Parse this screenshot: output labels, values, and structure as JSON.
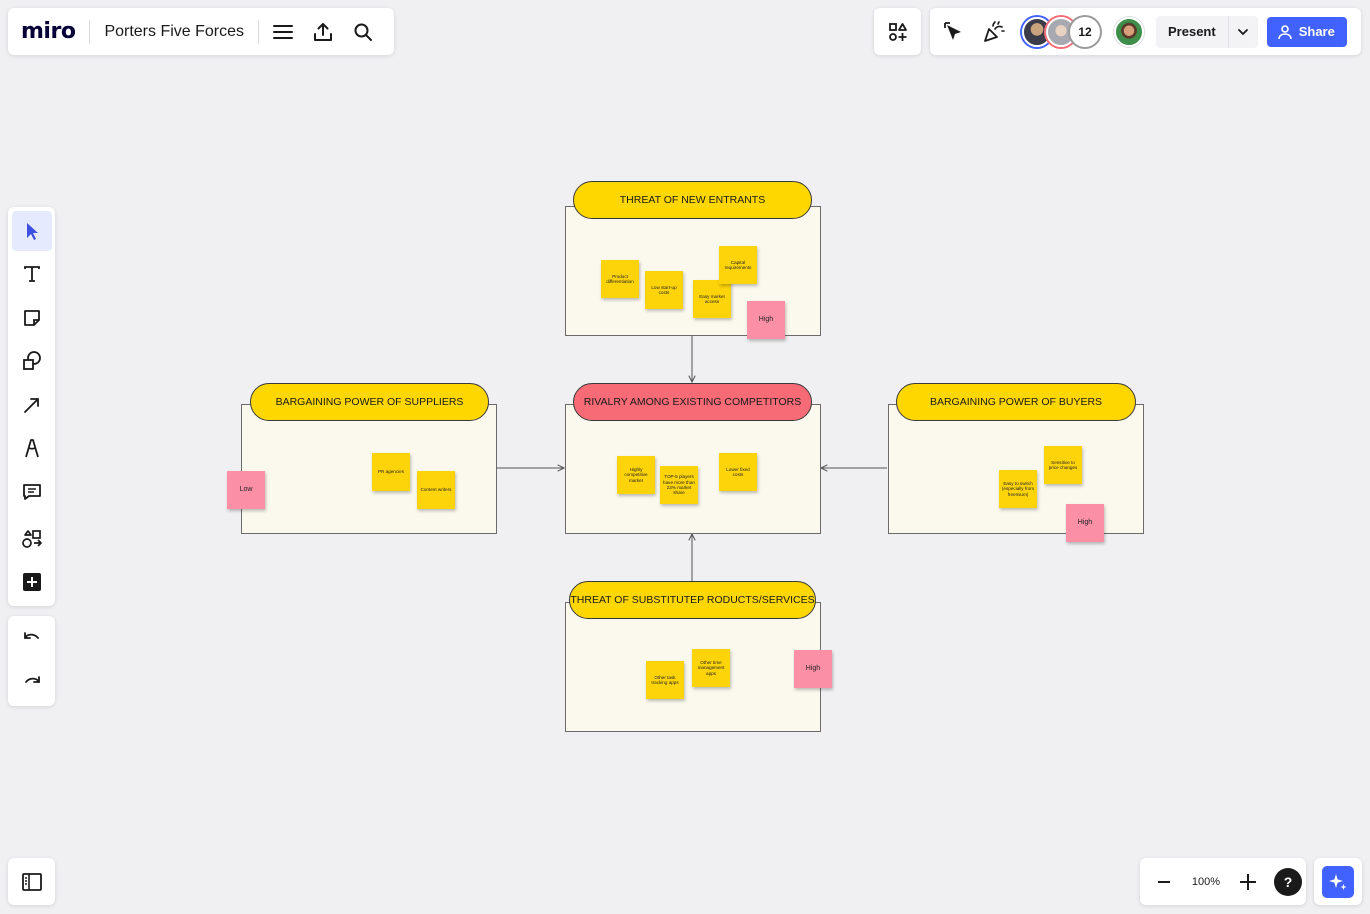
{
  "topbar": {
    "logo": "miro",
    "board_title": "Porters Five Forces"
  },
  "collaborators": {
    "count": "12"
  },
  "actions": {
    "present_label": "Present",
    "share_label": "Share"
  },
  "zoom": {
    "level": "100%",
    "help": "?"
  },
  "icons": {
    "menu": "hamburger-icon",
    "export": "upload-icon",
    "search": "search-icon",
    "apps": "apps-icon",
    "cursor_follow": "cursor-icon",
    "reactions": "party-popper-icon",
    "share": "user-icon",
    "ai": "sparkle-icon",
    "sidebar": "panel-icon"
  },
  "colors": {
    "accent": "#4262ff",
    "sticky_yellow": "#fdd40a",
    "sticky_pink": "#fb8fa5",
    "pill_yellow": "#ffd700",
    "pill_red": "#f76b76",
    "frame_bg": "#fbf8ee"
  },
  "board": {
    "new_entrants": {
      "title": "THREAT OF NEW ENTRANTS",
      "notes": [
        "Product differentiation",
        "Low start-up costs",
        "Easy market access",
        "Capital requirements"
      ],
      "level": "High"
    },
    "suppliers": {
      "title": "BARGAINING POWER OF SUPPLIERS",
      "notes": [
        "PR agencies",
        "Content writers"
      ],
      "level": "Low"
    },
    "rivalry": {
      "title": "RIVALRY AMONG EXISTING COMPETITORS",
      "notes": [
        "Highly competitive market",
        "TOP-5 players have more than 23% market share",
        "Lower fixed costs"
      ]
    },
    "buyers": {
      "title": "BARGAINING POWER OF BUYERS",
      "notes": [
        "Easy to switch (especially from freemium)",
        "Sensitive to price changes"
      ],
      "level": "High"
    },
    "substitutes": {
      "title": "THREAT OF SUBSTITUTEP RODUCTS/SERVICES",
      "notes": [
        "Other task tracking apps",
        "Other time management apps"
      ],
      "level": "High"
    }
  }
}
